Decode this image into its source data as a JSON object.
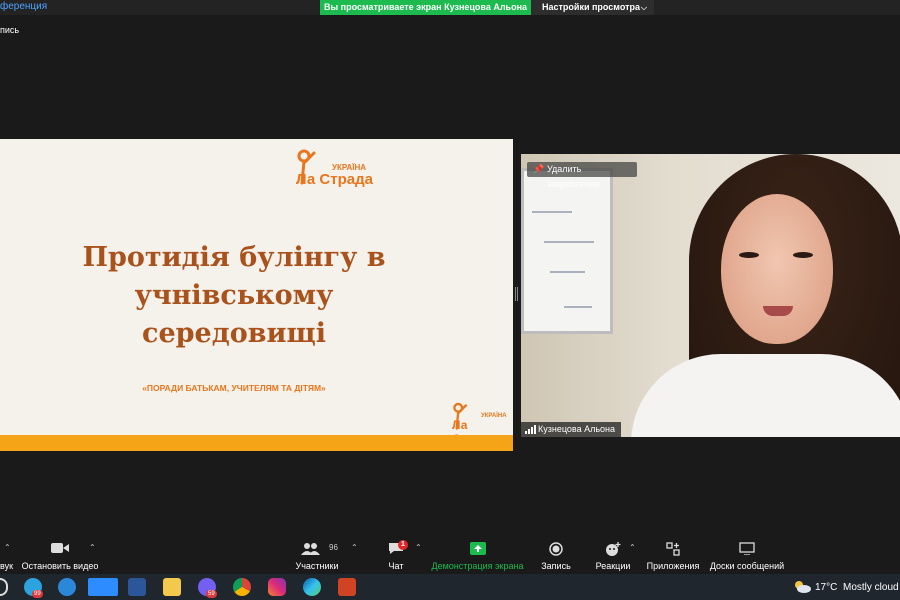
{
  "topbar": {
    "conference_title": "ференция",
    "sharing_banner": "Вы просматриваете экран Кузнецова Альона",
    "view_options": "Настройки просмотра",
    "recording_label": "пись"
  },
  "slide": {
    "logo_ukraina": "УКРАЇНА",
    "logo_lastrada": "Ла Страда",
    "title_line1": "Протидія булінгу в учнівському",
    "title_line2": "середовищі",
    "subtitle": "«ПОРАДИ БАТЬКАМ, УЧИТЕЛЯМ ТА ДІТЯМ»"
  },
  "video": {
    "unpin_label": "Удалить закрепление",
    "participant_name": "Кузнецова Альона"
  },
  "toolbar": {
    "audio_label": "вук",
    "stop_video_label": "Остановить видео",
    "participants_label": "Участники",
    "participants_count": "96",
    "chat_label": "Чат",
    "chat_badge": "1",
    "share_label": "Демонстрация экрана",
    "record_label": "Запись",
    "reactions_label": "Реакции",
    "apps_label": "Приложения",
    "whiteboard_label": "Доски сообщений"
  },
  "taskbar": {
    "telegram_badge": "99",
    "viber_badge": "59",
    "temperature": "17°C",
    "weather": "Mostly cloud"
  },
  "colors": {
    "accent_green": "#1dbb4f",
    "brand_orange": "#e8761c",
    "title_brown": "#a9521c",
    "slide_bar": "#f5a418"
  }
}
